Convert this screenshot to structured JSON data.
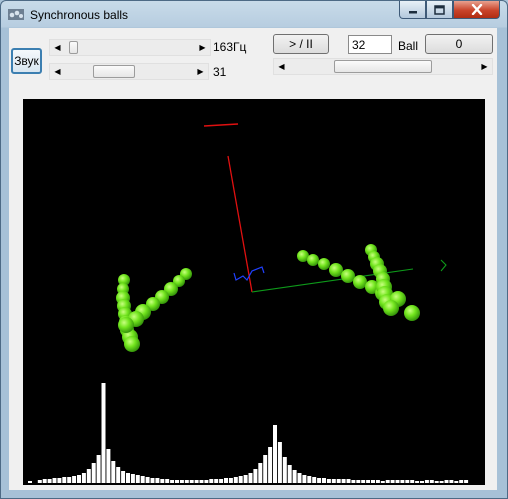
{
  "window": {
    "title": "Synchronous balls"
  },
  "controls": {
    "sound_button": "Звук",
    "frequency_label": "163Гц",
    "frequency_slider_percent": 3,
    "second_slider_value": "31",
    "second_slider_percent": 33,
    "play_pause_button": "> / II",
    "ball_count_value": "32",
    "ball_label": "Ball",
    "ball_button": "0",
    "wide_slider_percent": 50
  },
  "icons": {
    "app": "balls-app-icon",
    "minimize": "minimize-icon",
    "maximize": "maximize-icon",
    "close": "close-icon"
  },
  "colors": {
    "ball": "#6be01a",
    "ball_highlight": "#b8ff6a",
    "axis_red": "#e01010",
    "axis_green": "#0e9a1a",
    "axis_blue": "#2040ff",
    "spectrum": "#ffffff",
    "canvas_bg": "#000000"
  },
  "spectrum_values": [
    0.02,
    0.0,
    0.03,
    0.04,
    0.04,
    0.05,
    0.05,
    0.06,
    0.06,
    0.07,
    0.08,
    0.1,
    0.14,
    0.2,
    0.28,
    1.0,
    0.34,
    0.22,
    0.16,
    0.12,
    0.1,
    0.09,
    0.08,
    0.07,
    0.06,
    0.05,
    0.05,
    0.04,
    0.04,
    0.03,
    0.03,
    0.03,
    0.03,
    0.03,
    0.03,
    0.03,
    0.03,
    0.04,
    0.04,
    0.04,
    0.05,
    0.05,
    0.06,
    0.07,
    0.08,
    0.1,
    0.14,
    0.2,
    0.28,
    0.36,
    0.58,
    0.41,
    0.26,
    0.18,
    0.13,
    0.1,
    0.08,
    0.07,
    0.06,
    0.05,
    0.05,
    0.04,
    0.04,
    0.04,
    0.04,
    0.04,
    0.03,
    0.03,
    0.03,
    0.03,
    0.03,
    0.03,
    0.02,
    0.03,
    0.03,
    0.03,
    0.03,
    0.03,
    0.03,
    0.02,
    0.02,
    0.03,
    0.03,
    0.02,
    0.02,
    0.03,
    0.03,
    0.02,
    0.03,
    0.03
  ]
}
